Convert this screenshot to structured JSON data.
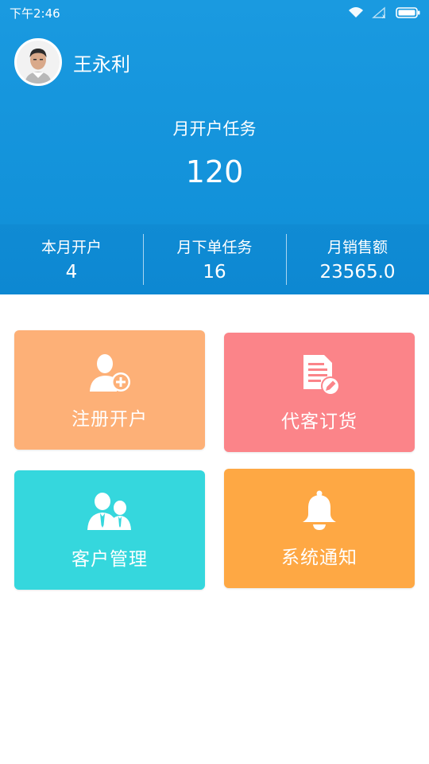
{
  "status_bar": {
    "time": "下午2:46",
    "icons": [
      "wifi-icon",
      "signal-icon",
      "battery-icon"
    ]
  },
  "profile": {
    "name": "王永利",
    "avatar_icon": "user-avatar"
  },
  "task": {
    "title": "月开户任务",
    "value": "120"
  },
  "stats": [
    {
      "label": "本月开户",
      "value": "4"
    },
    {
      "label": "月下单任务",
      "value": "16"
    },
    {
      "label": "月销售额",
      "value": "23565.0"
    }
  ],
  "tiles": [
    {
      "label": "注册开户",
      "icon": "add-user-icon",
      "color": "#fdb077"
    },
    {
      "label": "代客订货",
      "icon": "order-document-icon",
      "color": "#fb8489"
    },
    {
      "label": "客户管理",
      "icon": "customers-icon",
      "color": "#35d7dd"
    },
    {
      "label": "系统通知",
      "icon": "bell-icon",
      "color": "#fea844"
    }
  ],
  "colors": {
    "header": "#1296db",
    "text_light": "#ffffff"
  }
}
